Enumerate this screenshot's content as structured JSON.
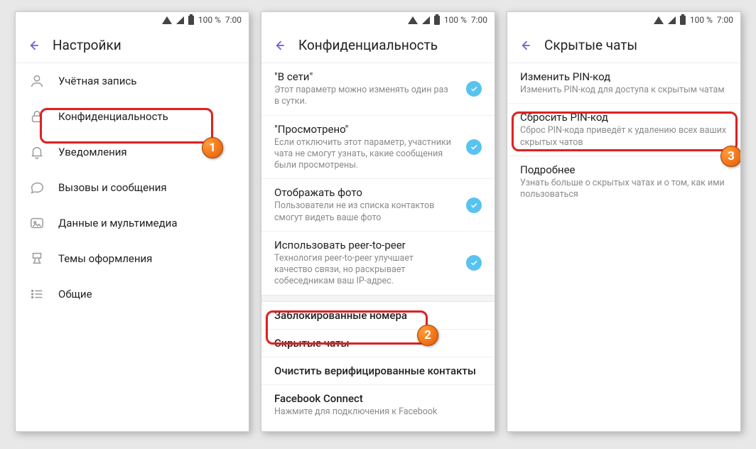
{
  "status": {
    "battery_text": "100 %",
    "time": "7:00"
  },
  "badges": {
    "b1": "1",
    "b2": "2",
    "b3": "3"
  },
  "screen1": {
    "title": "Настройки",
    "items": [
      {
        "label": "Учётная запись"
      },
      {
        "label": "Конфиденциальность"
      },
      {
        "label": "Уведомления"
      },
      {
        "label": "Вызовы и сообщения"
      },
      {
        "label": "Данные и мультимедиа"
      },
      {
        "label": "Темы оформления"
      },
      {
        "label": "Общие"
      }
    ]
  },
  "screen2": {
    "title": "Конфиденциальность",
    "items": [
      {
        "title": "\"В сети\"",
        "sub": "Этот параметр можно изменять один раз в сутки."
      },
      {
        "title": "\"Просмотрено\"",
        "sub": "Если отключить этот параметр, участники чата не смогут узнать, какие сообщения были просмотрены."
      },
      {
        "title": "Отображать фото",
        "sub": "Пользователи не из списка контактов смогут видеть ваше фото"
      },
      {
        "title": "Использовать peer-to-peer",
        "sub": "Технология peer-to-peer улучшает качество связи, но раскрывает собеседникам ваш IP-адрес."
      }
    ],
    "plain": [
      {
        "title": "Заблокированные номера"
      },
      {
        "title": "Скрытые чаты"
      },
      {
        "title": "Очистить верифицированные контакты"
      },
      {
        "title": "Facebook Connect",
        "sub": "Нажмите для подключения к Facebook"
      }
    ]
  },
  "screen3": {
    "title": "Скрытые чаты",
    "items": [
      {
        "title": "Изменить PIN-код",
        "sub": "Изменить PIN-код для доступа к скрытым чатам"
      },
      {
        "title": "Сбросить PIN-код",
        "sub": "Сброс PIN-кода приведёт к удалению всех ваших скрытых чатов"
      },
      {
        "title": "Подробнее",
        "sub": "Узнать больше о скрытых чатах и о том, как ими пользоваться"
      }
    ]
  }
}
